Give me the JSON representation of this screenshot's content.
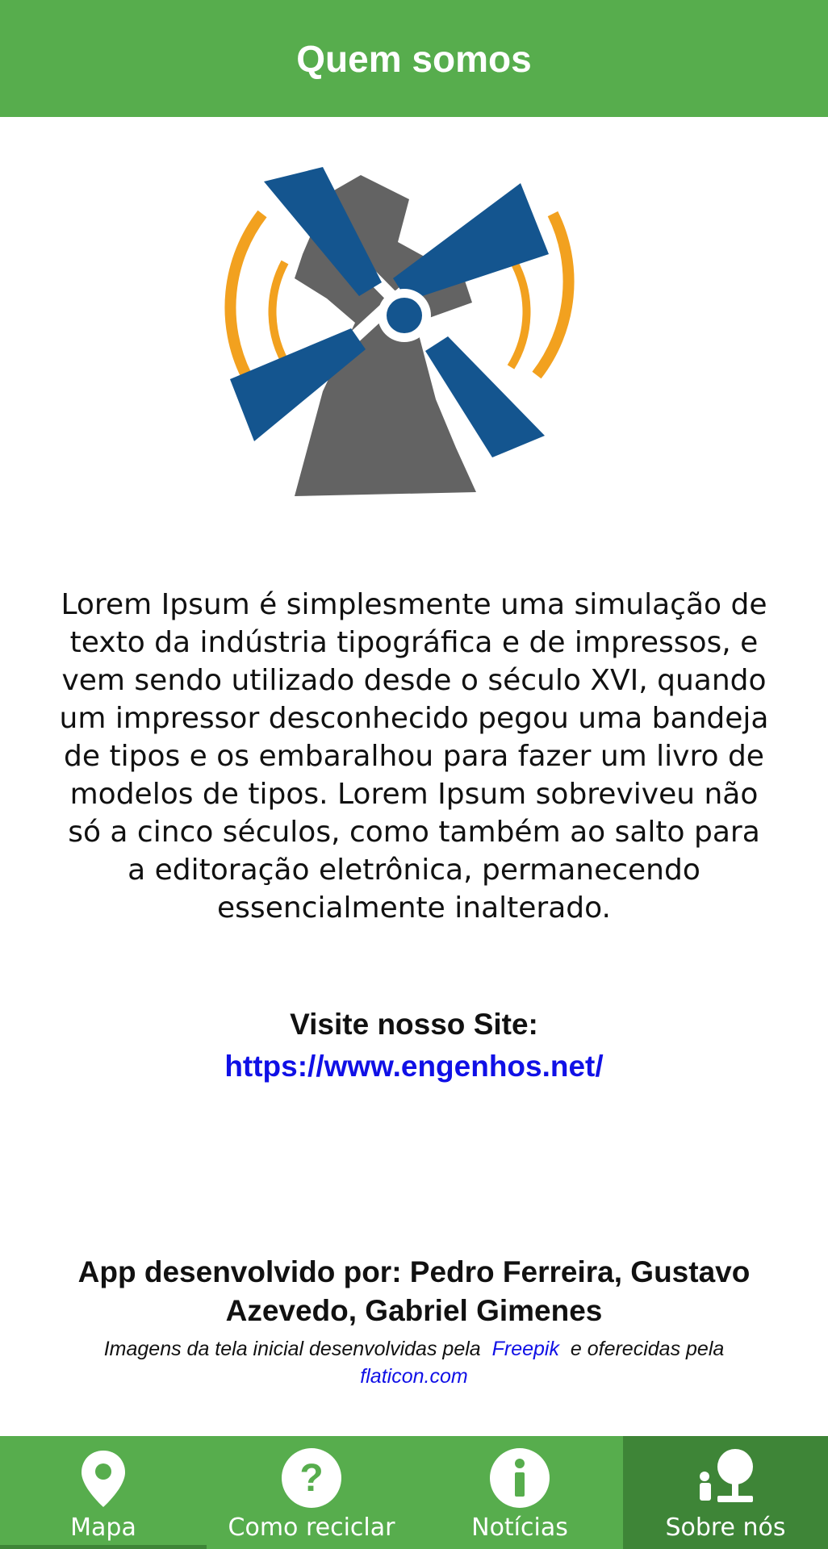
{
  "app_bar": {
    "title": "Quem somos"
  },
  "description": "Lorem Ipsum é simplesmente uma simulação de texto da indústria tipográfica e de impressos, e vem sendo utilizado desde o século XVI, quando um impressor desconhecido pegou uma bandeja de tipos e os embaralhou para fazer um livro de modelos de tipos. Lorem Ipsum sobreviveu não só a cinco séculos, como também ao salto para a editoração eletrônica, permanecendo essencialmente inalterado.",
  "visit": {
    "label": "Visite nosso Site:",
    "url": "https://www.engenhos.net/"
  },
  "credits": {
    "developers": "App desenvolvido por: Pedro Ferreira, Gustavo Azevedo, Gabriel Gimenes",
    "images_prefix": "Imagens da tela inicial desenvolvidas pela",
    "freepik": "Freepik",
    "images_middle": "e oferecidas pela",
    "flaticon": "flaticon.com"
  },
  "bottom_nav": {
    "items": [
      {
        "label": "Mapa",
        "icon": "map-pin-icon"
      },
      {
        "label": "Como reciclar",
        "icon": "question-icon"
      },
      {
        "label": "Notícias",
        "icon": "info-icon"
      },
      {
        "label": "Sobre nós",
        "icon": "about-us-icon",
        "active": true
      }
    ]
  },
  "colors": {
    "primary_green": "#57ad4d",
    "active_green": "#3e8537",
    "link_blue": "#1010e6",
    "logo_blue": "#14558f",
    "logo_gray": "#636363",
    "logo_orange": "#f2a11f"
  }
}
